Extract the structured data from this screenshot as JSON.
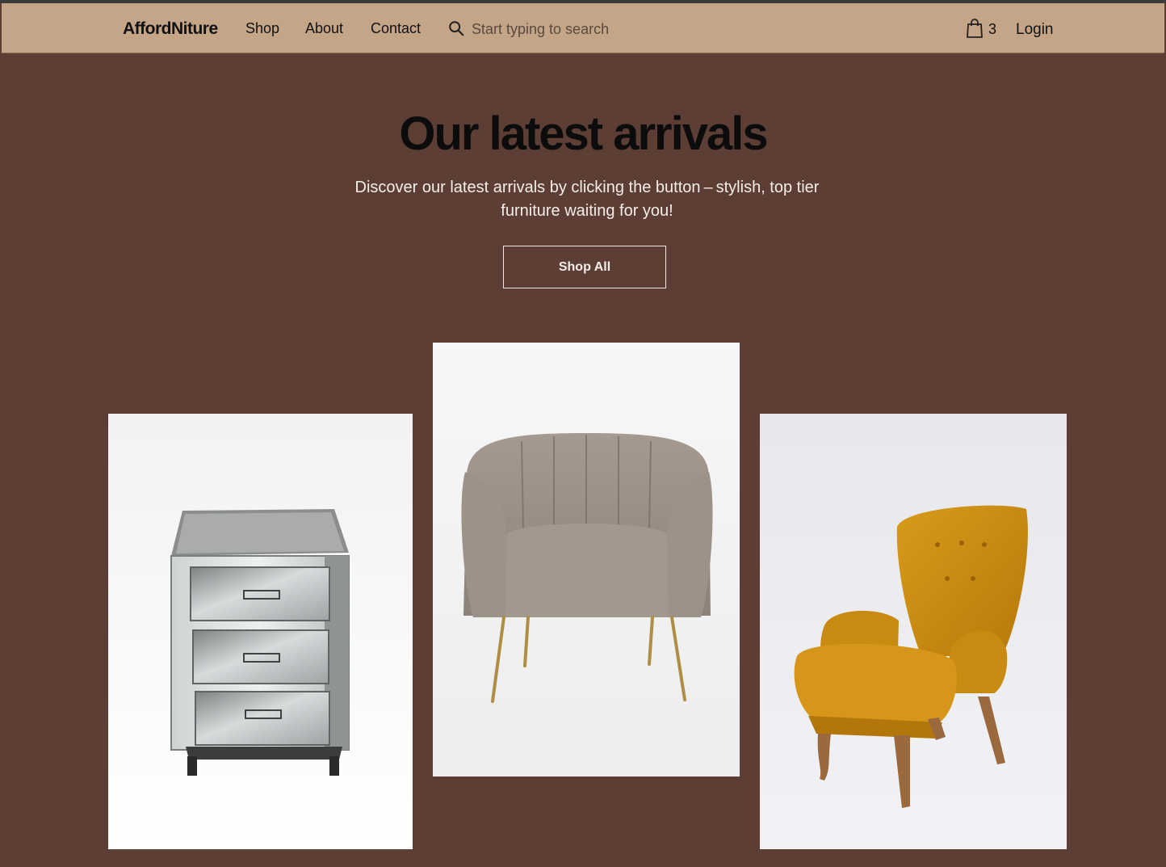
{
  "brand": {
    "name": "AffordNiture"
  },
  "nav": {
    "links": [
      "Shop",
      "About",
      "Contact"
    ],
    "search_placeholder": "Start typing to search",
    "cart_count": "3",
    "login_label": "Login"
  },
  "hero": {
    "title": "Our latest arrivals",
    "subtitle": "Discover our latest arrivals by clicking the button – stylish, top tier furniture waiting for you!",
    "cta_label": "Shop All"
  },
  "products": [
    {
      "icon": "mirrored-nightstand-image"
    },
    {
      "icon": "taupe-velvet-armchair-image"
    },
    {
      "icon": "mustard-velvet-armchair-image"
    }
  ],
  "colors": {
    "background": "#5c3e34",
    "nav_background": "#c4a588",
    "text_dark": "#111111",
    "text_light": "#f4ede8"
  }
}
